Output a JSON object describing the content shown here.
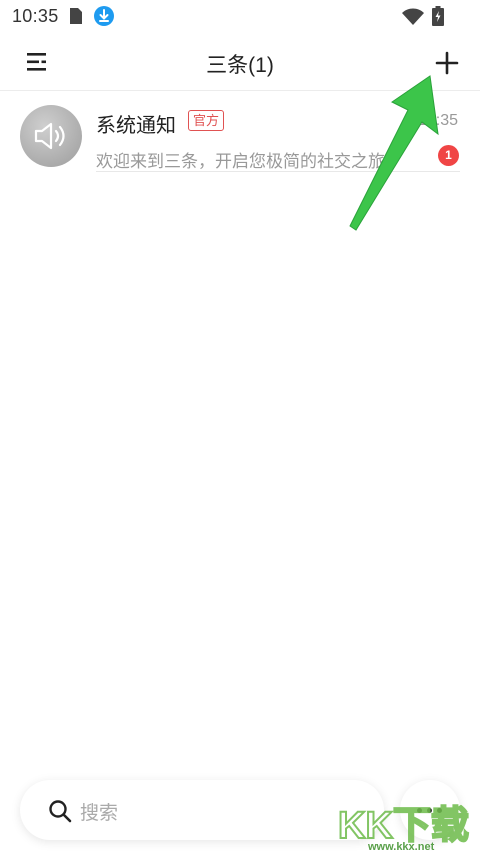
{
  "status_bar": {
    "time": "10:35"
  },
  "header": {
    "title": "三条(1)"
  },
  "chats": [
    {
      "name": "系统通知",
      "badge": "官方",
      "time": "10:35",
      "preview": "欢迎来到三条，开启您极简的社交之旅",
      "unread": "1"
    }
  ],
  "search": {
    "placeholder": "搜索"
  },
  "watermark": {
    "logo_text": "KK下载",
    "url": "www.kkx.net"
  },
  "colors": {
    "accent_red": "#e05252",
    "unread_red": "#f04545",
    "arrow_green": "#3cc54a",
    "download_blue": "#1e9bf0"
  },
  "icons": {
    "menu": "menu-icon",
    "add": "add-icon",
    "search": "search-icon",
    "more": "more-dots-icon",
    "avatar": "speaker-icon"
  }
}
